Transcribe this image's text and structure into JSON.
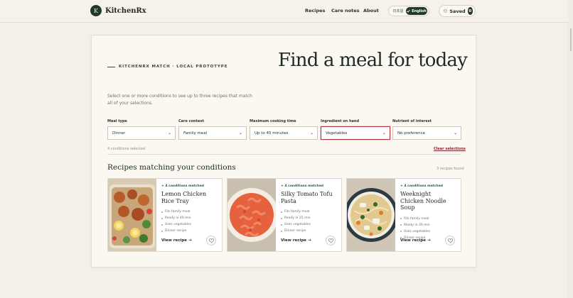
{
  "header": {
    "brand_initial": "K",
    "brand_name": "KitchenRx",
    "nav": [
      "Recipes",
      "Care notes",
      "About"
    ],
    "lang_ja": "日本語",
    "lang_en": "English",
    "saved_label": "Saved",
    "saved_count": "0"
  },
  "hero": {
    "eyebrow": "KITCHENRX MATCH · LOCAL PROTOTYPE",
    "title": "Find a meal for today",
    "intro": "Select one or more conditions to see up to three recipes that match all of your selections."
  },
  "filters": [
    {
      "label": "Meal type",
      "value": "Dinner"
    },
    {
      "label": "Care context",
      "value": "Family meal"
    },
    {
      "label": "Maximum cooking time",
      "value": "Up to 45 minutes"
    },
    {
      "label": "Ingredient on hand",
      "value": "Vegetables"
    },
    {
      "label": "Nutrient of interest",
      "value": "No preference"
    }
  ],
  "conditions_selected": "4 conditions selected",
  "clear_label": "Clear selections",
  "results": {
    "title": "Recipes matching your conditions",
    "count": "3 recipes found"
  },
  "recipes": [
    {
      "match": "4 conditions matched",
      "title": "Lemon Chicken Rice Tray",
      "tags": [
        "Fits family meal",
        "Ready in 40 min",
        "Uses vegetables",
        "Dinner recipe"
      ],
      "view": "View recipe"
    },
    {
      "match": "4 conditions matched",
      "title": "Silky Tomato Tofu Pasta",
      "tags": [
        "Fits family meal",
        "Ready in 25 min",
        "Uses vegetables",
        "Dinner recipe"
      ],
      "view": "View recipe"
    },
    {
      "match": "4 conditions matched",
      "title": "Weeknight Chicken Noodle Soup",
      "tags": [
        "Fits family meal",
        "Ready in 30 min",
        "Uses vegetables",
        "Dinner recipe"
      ],
      "view": "View recipe"
    }
  ]
}
